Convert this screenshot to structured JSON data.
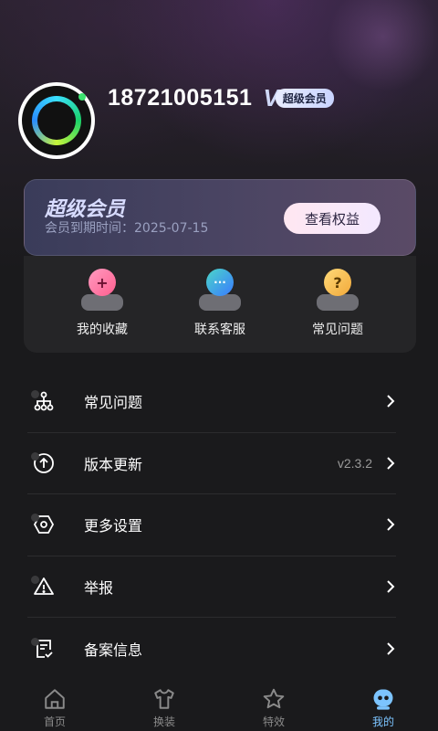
{
  "user": {
    "phone": "18721005151",
    "vip_letter": "V",
    "vip_badge": "超级会员"
  },
  "membership": {
    "title": "超级会员",
    "expiry": "会员到期时间：2025-07-15",
    "button": "查看权益"
  },
  "quick_actions": [
    {
      "label": "我的收藏",
      "icon": "heart-plus-icon",
      "color": "#ff6fa0",
      "glyph": "+"
    },
    {
      "label": "联系客服",
      "icon": "chat-bubble-icon",
      "color": "#4ab8ff",
      "glyph": "···"
    },
    {
      "label": "常见问题",
      "icon": "question-icon",
      "color": "#f6c14a",
      "glyph": "?"
    }
  ],
  "menu": [
    {
      "label": "常见问题",
      "icon": "sitemap-icon",
      "value": ""
    },
    {
      "label": "版本更新",
      "icon": "upload-circle-icon",
      "value": "v2.3.2"
    },
    {
      "label": "更多设置",
      "icon": "settings-hexagon-icon",
      "value": ""
    },
    {
      "label": "举报",
      "icon": "warning-triangle-icon",
      "value": ""
    },
    {
      "label": "备案信息",
      "icon": "document-check-icon",
      "value": ""
    }
  ],
  "tabs": [
    {
      "label": "首页",
      "icon": "home-icon",
      "active": false
    },
    {
      "label": "换装",
      "icon": "shirt-icon",
      "active": false
    },
    {
      "label": "特效",
      "icon": "star-icon",
      "active": false
    },
    {
      "label": "我的",
      "icon": "robot-avatar-icon",
      "active": true
    }
  ],
  "colors": {
    "background": "#1a1a1c",
    "panel": "#252527",
    "active_tab": "#7cc4ff"
  }
}
